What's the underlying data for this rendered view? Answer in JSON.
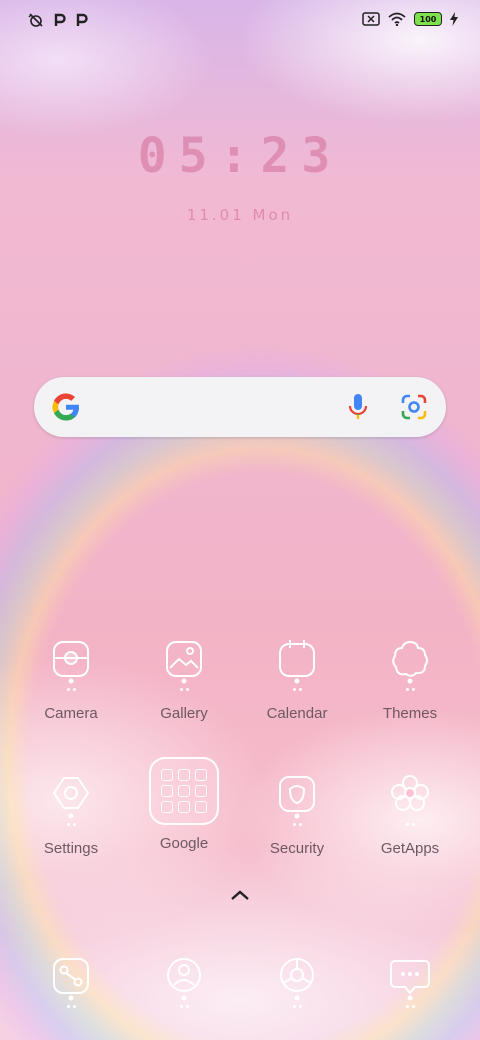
{
  "status_bar": {
    "left_icons": [
      "alarm-off-icon",
      "p-notification-icon",
      "p-notification-icon"
    ],
    "battery_level": "100",
    "right_icons": [
      "no-sim-icon",
      "wifi-icon",
      "battery-icon",
      "charging-icon"
    ]
  },
  "clock": {
    "time": "05:23",
    "date": "11.01 Mon"
  },
  "search": {
    "icons": [
      "google-logo-icon",
      "mic-icon",
      "lens-icon"
    ]
  },
  "apps": [
    {
      "label": "Camera"
    },
    {
      "label": "Gallery"
    },
    {
      "label": "Calendar"
    },
    {
      "label": "Themes"
    },
    {
      "label": "Settings"
    },
    {
      "label": "Google"
    },
    {
      "label": "Security"
    },
    {
      "label": "GetApps"
    }
  ],
  "dock": [
    "phone-icon",
    "contacts-icon",
    "browser-icon",
    "messages-icon"
  ],
  "colors": {
    "icon_stroke": "#ffffff",
    "clock_text": "#d26e96",
    "label_text": "#6e5963"
  }
}
